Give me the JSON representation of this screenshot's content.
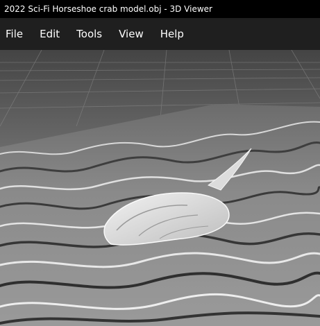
{
  "window": {
    "title": "2022 Sci-Fi Horseshoe crab model.obj - 3D Viewer"
  },
  "menu": {
    "items": [
      {
        "label": "File"
      },
      {
        "label": "Edit"
      },
      {
        "label": "Tools"
      },
      {
        "label": "View"
      },
      {
        "label": "Help"
      }
    ]
  },
  "viewport": {
    "background_color": "#6e6e6e",
    "terrain_color": "#8c8c8c",
    "model_color": "#e6e6e6"
  }
}
